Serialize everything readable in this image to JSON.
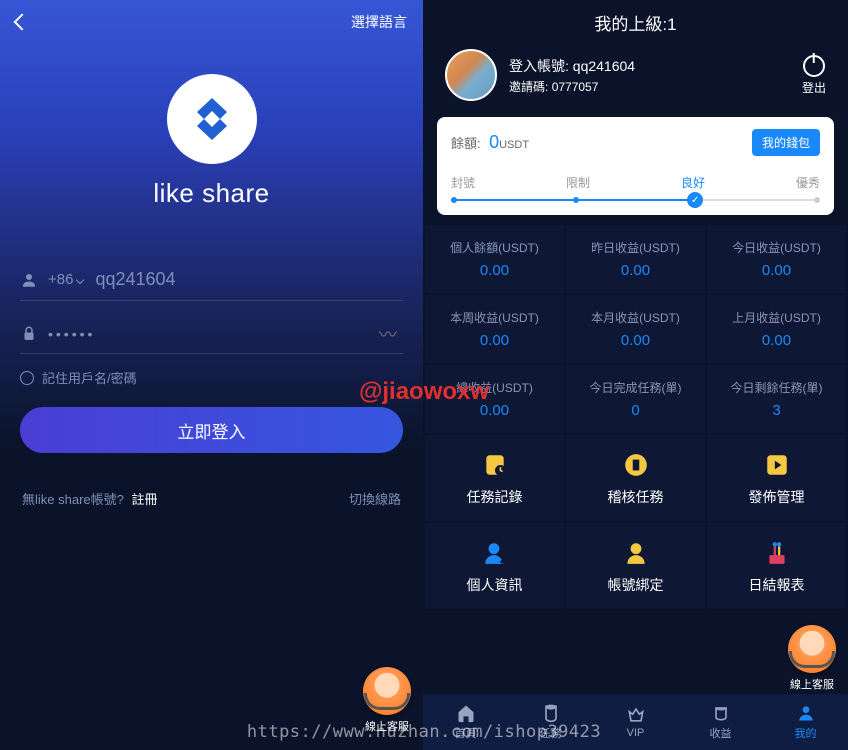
{
  "left": {
    "language_label": "選擇語言",
    "brand": "like share",
    "country_code": "+86",
    "username": "qq241604",
    "password_mask": "••••••",
    "remember": "記住用戶名/密碼",
    "login_btn": "立即登入",
    "no_account": "無like share帳號?",
    "register": "註冊",
    "switch_line": "切換線路",
    "support": "線上客服"
  },
  "right": {
    "title": "我的上級:1",
    "login_label": "登入帳號:",
    "login_account": "qq241604",
    "invite_label": "邀請碼:",
    "invite_code": "0777057",
    "logout": "登出",
    "balance_label": "餘額:",
    "balance_value": "0",
    "balance_unit": "USDT",
    "wallet_btn": "我的錢包",
    "status": {
      "blocked": "封號",
      "limited": "限制",
      "good": "良好",
      "excellent": "優秀",
      "active_index": 2
    },
    "stats": [
      {
        "label": "個人餘額(USDT)",
        "value": "0.00"
      },
      {
        "label": "昨日收益(USDT)",
        "value": "0.00"
      },
      {
        "label": "今日收益(USDT)",
        "value": "0.00"
      },
      {
        "label": "本周收益(USDT)",
        "value": "0.00"
      },
      {
        "label": "本月收益(USDT)",
        "value": "0.00"
      },
      {
        "label": "上月收益(USDT)",
        "value": "0.00"
      },
      {
        "label": "總收益(USDT)",
        "value": "0.00"
      },
      {
        "label": "今日完成任務(單)",
        "value": "0"
      },
      {
        "label": "今日剩餘任務(單)",
        "value": "3"
      }
    ],
    "actions_row1": [
      {
        "label": "任務記錄",
        "icon": "task-record-icon",
        "color": "#f5c842"
      },
      {
        "label": "稽核任務",
        "icon": "audit-task-icon",
        "color": "#f5c842"
      },
      {
        "label": "發佈管理",
        "icon": "publish-icon",
        "color": "#f5c842"
      }
    ],
    "actions_row2": [
      {
        "label": "個人資訊",
        "icon": "profile-icon",
        "color": "#1989fa"
      },
      {
        "label": "帳號綁定",
        "icon": "bind-icon",
        "color": "#f5c842"
      },
      {
        "label": "日結報表",
        "icon": "report-icon",
        "color": "#e04060"
      }
    ],
    "nav": [
      {
        "label": "首頁",
        "icon": "home-icon"
      },
      {
        "label": "任務",
        "icon": "task-icon"
      },
      {
        "label": "VIP",
        "icon": "vip-icon"
      },
      {
        "label": "收益",
        "icon": "earnings-icon"
      },
      {
        "label": "我的",
        "icon": "mine-icon",
        "active": true
      }
    ],
    "support": "線上客服"
  },
  "watermark": "@jiaowoxw",
  "url_watermark": "https://www.huzhan.com/ishop39423"
}
